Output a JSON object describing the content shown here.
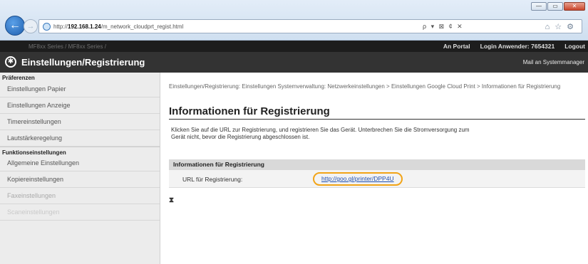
{
  "browser": {
    "url_prefix": "http://",
    "url_host": "192.168.1.24",
    "url_path": "/m_network_cloudprt_regist.html",
    "address_tools": "ρ ▾ ⊠ ¢ ✕",
    "window_buttons": [
      "—",
      "▭",
      "✕"
    ]
  },
  "topbar": {
    "device_name": "MF8xx Series / MF8xx Series /",
    "portal_link": "An Portal",
    "login_label": "Login Anwender:",
    "login_user": "7654321",
    "logout": "Logout"
  },
  "titlebar": {
    "title": "Einstellungen/Registrierung",
    "mail_admin": "Mail an Systemmanager"
  },
  "sidebar": {
    "section1_header": "Präferenzen",
    "section1_items": [
      "Einstellungen Papier",
      "Einstellungen Anzeige",
      "Timereinstellungen",
      "Lautstärkeregelung"
    ],
    "section2_header": "Funktionseinstellungen",
    "section2_items": [
      "Allgemeine Einstellungen",
      "Kopiereinstellungen",
      "Faxeinstellungen",
      "Scaneinstellungen"
    ]
  },
  "main": {
    "breadcrumb": "Einstellungen/Registrierung: Einstellungen Systemverwaltung: Netzwerkeinstellungen > Einstellungen Google Cloud Print > Informationen für Registrierung",
    "page_title": "Informationen für Registrierung",
    "description": "Klicken Sie auf die URL zur Registrierung, und registrieren Sie das Gerät. Unterbrechen Sie die Stromversorgung zum Gerät nicht, bevor die Registrierung abgeschlossen ist.",
    "panel_header": "Informationen für Registrierung",
    "row_label": "URL für Registrierung:",
    "row_link": "http://goo.gl/printer/DPP4U",
    "top_anchor": "⧗"
  },
  "colors": {
    "highlight_ring": "#f2a417",
    "link": "#1f4fb0",
    "titlebar_bg": "#333333",
    "topbar_bg": "#1d1d1d"
  }
}
